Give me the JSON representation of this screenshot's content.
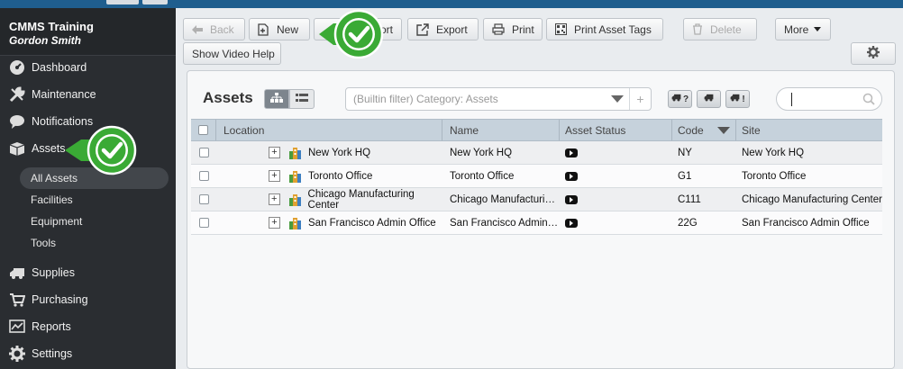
{
  "app": {
    "name": "CMMS Training",
    "user": "Gordon Smith"
  },
  "sidebar": {
    "items": [
      {
        "label": "Dashboard",
        "icon": "dashboard-icon"
      },
      {
        "label": "Maintenance",
        "icon": "wrench-icon"
      },
      {
        "label": "Notifications",
        "icon": "speech-bubble-icon"
      },
      {
        "label": "Assets",
        "icon": "boxes-icon"
      },
      {
        "label": "Supplies",
        "icon": "truck-icon"
      },
      {
        "label": "Purchasing",
        "icon": "cart-icon"
      },
      {
        "label": "Reports",
        "icon": "chart-icon"
      },
      {
        "label": "Settings",
        "icon": "gear-icon"
      }
    ],
    "asset_subitems": [
      "All Assets",
      "Facilities",
      "Equipment",
      "Tools"
    ],
    "active_subitem": "All Assets"
  },
  "toolbar": {
    "back": "Back",
    "new": "New",
    "import_partial": "ort",
    "export": "Export",
    "print": "Print",
    "print_tags": "Print Asset Tags",
    "delete": "Delete",
    "more": "More",
    "video_help": "Show Video Help"
  },
  "panel": {
    "title": "Assets",
    "filter_placeholder": "(Builtin filter) Category: Assets",
    "filter_plus": "+",
    "truck_buttons": [
      "?",
      "",
      "!"
    ]
  },
  "grid": {
    "columns": [
      "Location",
      "Name",
      "Asset Status",
      "Code",
      "Site"
    ],
    "rows": [
      {
        "location": "New York HQ",
        "name": "New York HQ",
        "code": "NY",
        "site": "New York HQ"
      },
      {
        "location": "Toronto Office",
        "name": "Toronto Office",
        "code": "G1",
        "site": "Toronto Office"
      },
      {
        "location": "Chicago Manufacturing Center",
        "name": "Chicago Manufacturing...",
        "code": "C111",
        "site": "Chicago Manufacturing Center"
      },
      {
        "location": "San Francisco Admin Office",
        "name": "San Francisco Admin O...",
        "code": "22G",
        "site": "San Francisco Admin Office"
      }
    ]
  },
  "colors": {
    "sidebar": "#2a2d31",
    "accent_green": "#3aaa35",
    "header_blue": "#1f5e8e"
  }
}
